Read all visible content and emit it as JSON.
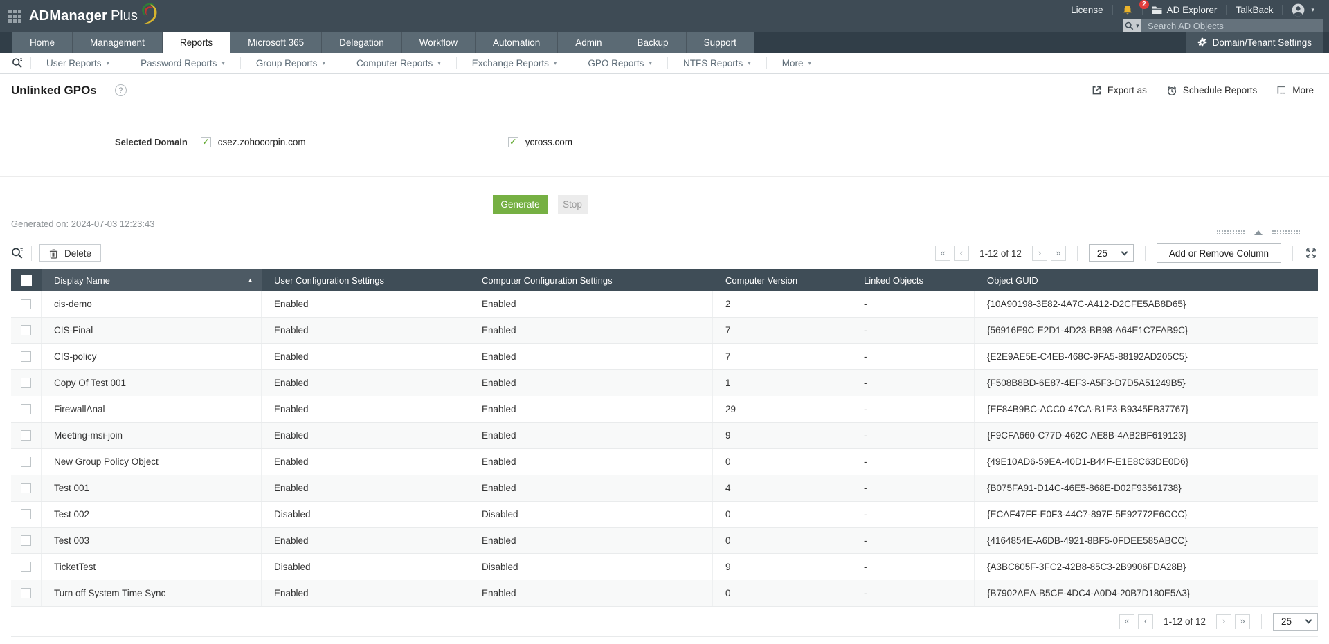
{
  "topbar": {
    "logo_primary": "ADManager",
    "logo_secondary": "Plus",
    "license_label": "License",
    "notification_count": "2",
    "ad_explorer_label": "AD Explorer",
    "talkback_label": "TalkBack",
    "search_placeholder": "Search AD Objects"
  },
  "nav": {
    "tabs": [
      "Home",
      "Management",
      "Reports",
      "Microsoft 365",
      "Delegation",
      "Workflow",
      "Automation",
      "Admin",
      "Backup",
      "Support"
    ],
    "active_tab": "Reports",
    "domain_tenant_settings_label": "Domain/Tenant Settings"
  },
  "reports_nav": {
    "items": [
      "User Reports",
      "Password Reports",
      "Group Reports",
      "Computer Reports",
      "Exchange Reports",
      "GPO Reports",
      "NTFS Reports",
      "More"
    ],
    "caret_glyph": "▾"
  },
  "page": {
    "title": "Unlinked GPOs",
    "help_glyph": "?",
    "actions": {
      "export_label": "Export as",
      "schedule_label": "Schedule Reports",
      "more_label": "More"
    },
    "selected_domain_label": "Selected Domain",
    "domains": [
      {
        "name": "csez.zohocorpin.com",
        "checked": true
      },
      {
        "name": "ycross.com",
        "checked": true
      }
    ],
    "generate_label": "Generate",
    "stop_label": "Stop",
    "generated_on": "Generated on: 2024-07-03 12:23:43"
  },
  "icons": {
    "check_glyph": "✓"
  },
  "grid": {
    "delete_label": "Delete",
    "pager": {
      "first": "«",
      "prev": "‹",
      "range": "1-12 of 12",
      "next": "›",
      "last": "»",
      "page_size": "25"
    },
    "add_remove_label": "Add or Remove Column",
    "sort": {
      "column": "Display Name",
      "direction": "asc",
      "glyph": "▲"
    },
    "columns": [
      "Display Name",
      "User Configuration Settings",
      "Computer Configuration Settings",
      "Computer Version",
      "Linked Objects",
      "Object GUID"
    ],
    "rows": [
      {
        "display_name": "cis-demo",
        "user_config": "Enabled",
        "computer_config": "Enabled",
        "computer_version": "2",
        "linked_objects": "-",
        "object_guid": "{10A90198-3E82-4A7C-A412-D2CFE5AB8D65}"
      },
      {
        "display_name": "CIS-Final",
        "user_config": "Enabled",
        "computer_config": "Enabled",
        "computer_version": "7",
        "linked_objects": "-",
        "object_guid": "{56916E9C-E2D1-4D23-BB98-A64E1C7FAB9C}"
      },
      {
        "display_name": "CIS-policy",
        "user_config": "Enabled",
        "computer_config": "Enabled",
        "computer_version": "7",
        "linked_objects": "-",
        "object_guid": "{E2E9AE5E-C4EB-468C-9FA5-88192AD205C5}"
      },
      {
        "display_name": "Copy Of Test 001",
        "user_config": "Enabled",
        "computer_config": "Enabled",
        "computer_version": "1",
        "linked_objects": "-",
        "object_guid": "{F508B8BD-6E87-4EF3-A5F3-D7D5A51249B5}"
      },
      {
        "display_name": "FirewallAnal",
        "user_config": "Enabled",
        "computer_config": "Enabled",
        "computer_version": "29",
        "linked_objects": "-",
        "object_guid": "{EF84B9BC-ACC0-47CA-B1E3-B9345FB37767}"
      },
      {
        "display_name": "Meeting-msi-join",
        "user_config": "Enabled",
        "computer_config": "Enabled",
        "computer_version": "9",
        "linked_objects": "-",
        "object_guid": "{F9CFA660-C77D-462C-AE8B-4AB2BF619123}"
      },
      {
        "display_name": "New Group Policy Object",
        "user_config": "Enabled",
        "computer_config": "Enabled",
        "computer_version": "0",
        "linked_objects": "-",
        "object_guid": "{49E10AD6-59EA-40D1-B44F-E1E8C63DE0D6}"
      },
      {
        "display_name": "Test 001",
        "user_config": "Enabled",
        "computer_config": "Enabled",
        "computer_version": "4",
        "linked_objects": "-",
        "object_guid": "{B075FA91-D14C-46E5-868E-D02F93561738}"
      },
      {
        "display_name": "Test 002",
        "user_config": "Disabled",
        "computer_config": "Disabled",
        "computer_version": "0",
        "linked_objects": "-",
        "object_guid": "{ECAF47FF-E0F3-44C7-897F-5E92772E6CCC}"
      },
      {
        "display_name": "Test 003",
        "user_config": "Enabled",
        "computer_config": "Enabled",
        "computer_version": "0",
        "linked_objects": "-",
        "object_guid": "{4164854E-A6DB-4921-8BF5-0FDEE585ABCC}"
      },
      {
        "display_name": "TicketTest",
        "user_config": "Disabled",
        "computer_config": "Disabled",
        "computer_version": "9",
        "linked_objects": "-",
        "object_guid": "{A3BC605F-3FC2-42B8-85C3-2B9906FDA28B}"
      },
      {
        "display_name": "Turn off System Time Sync",
        "user_config": "Enabled",
        "computer_config": "Enabled",
        "computer_version": "0",
        "linked_objects": "-",
        "object_guid": "{B7902AEA-B5CE-4DC4-A0D4-20B7D180E5A3}"
      }
    ]
  },
  "colors": {
    "brand_green": "#76b043",
    "header_slate": "#3f4d57",
    "badge_red": "#e03c3c"
  }
}
